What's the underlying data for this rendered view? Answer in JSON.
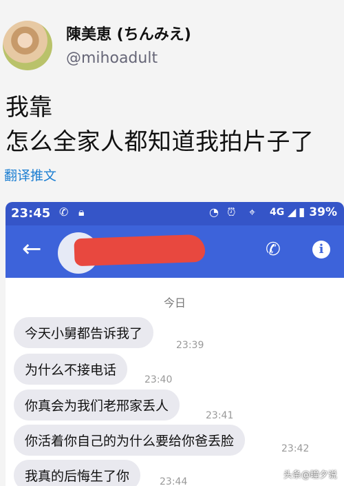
{
  "tweet": {
    "display_name": "陳美恵 (ちんみえ)",
    "handle": "@mihoadult",
    "line1": "我靠",
    "line2": "怎么全家人都知道我拍片子了",
    "translate_label": "翻译推文"
  },
  "phone": {
    "status": {
      "time": "23:45",
      "network": "4G",
      "battery": "39%"
    },
    "chat": {
      "date_label": "今日",
      "messages": [
        {
          "text": "今天小舅都告诉我了",
          "time": "23:39"
        },
        {
          "text": "为什么不接电话",
          "time": "23:40"
        },
        {
          "text": "你真会为我们老邢家丢人",
          "time": "23:41"
        },
        {
          "text": "你活着你自己的为什么要给你爸丢脸",
          "time": "23:42"
        },
        {
          "text": "我真的后悔生了你",
          "time": "23:44"
        }
      ]
    }
  },
  "watermark": "头条@瞳夕说",
  "colors": {
    "status_bar": "#3555c8",
    "app_bar": "#3d63da",
    "link": "#1d7fd2",
    "redaction": "#e8483f",
    "bubble": "#e9e9ef"
  }
}
